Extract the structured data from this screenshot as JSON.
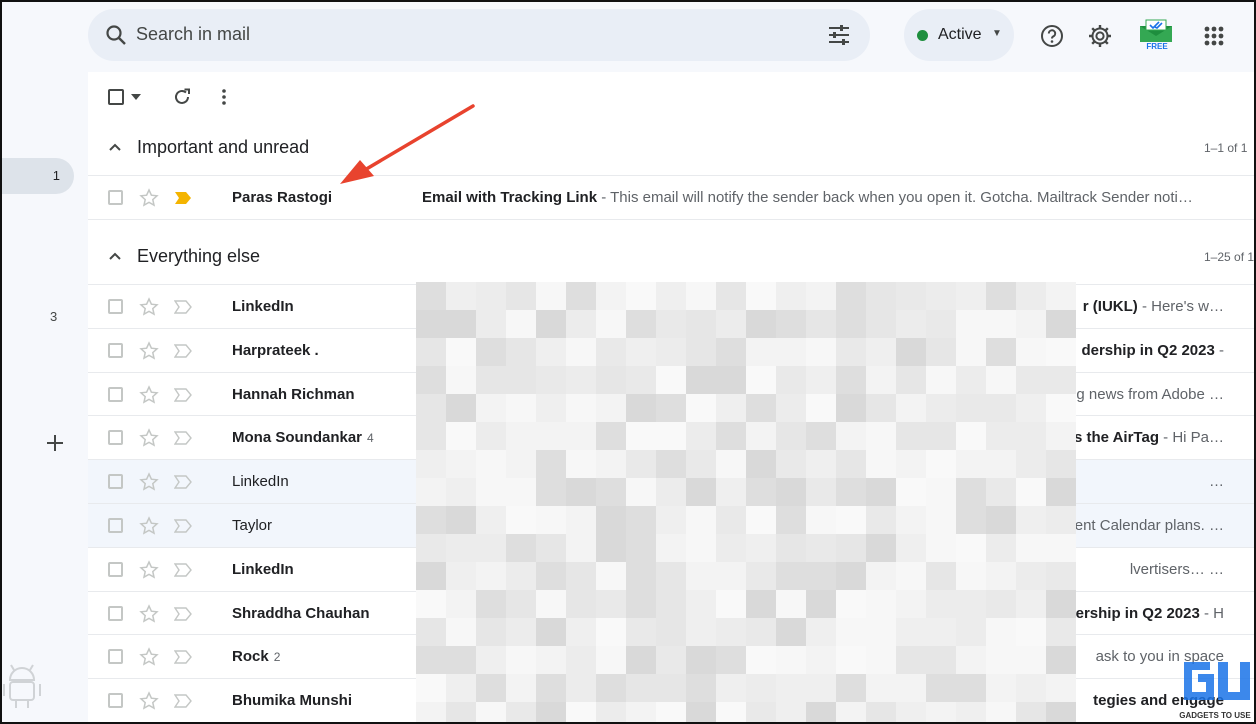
{
  "search": {
    "placeholder": "Search in mail"
  },
  "status": {
    "label": "Active"
  },
  "extension": {
    "badge": "FREE"
  },
  "rail": {
    "badge_count": "1",
    "other_count": "3"
  },
  "sections": [
    {
      "title": "Important and unread",
      "range": "1–1 of 1"
    },
    {
      "title": "Everything else",
      "range": "1–25 of 1"
    }
  ],
  "important_rows": [
    {
      "sender": "Paras Rastogi",
      "count": "",
      "subject": "Email with Tracking Link",
      "snippet": " - This email will notify the sender back when you open it. Gotcha. Mailtrack Sender noti…",
      "important": true,
      "unread": true
    }
  ],
  "rows": [
    {
      "sender": "LinkedIn",
      "count": "",
      "tail_bold": "r (IUKL)",
      "tail_snip": " - Here's w…",
      "unread": true
    },
    {
      "sender": "Harprateek .",
      "count": "",
      "tail_bold": "dership in Q2 2023",
      "tail_snip": " - ",
      "unread": true
    },
    {
      "sender": "Hannah Richman",
      "count": "",
      "tail_bold": "",
      "tail_snip": "g news from Adobe …",
      "unread": true
    },
    {
      "sender": "Mona Soundankar",
      "count": "4",
      "tail_bold": "s the AirTag",
      "tail_snip": " - Hi Pa…",
      "unread": true
    },
    {
      "sender": "LinkedIn",
      "count": "",
      "tail_bold": "",
      "tail_snip": "…",
      "unread": false
    },
    {
      "sender": "Taylor",
      "count": "",
      "tail_bold": "",
      "tail_snip": "ent Calendar plans. …",
      "unread": false
    },
    {
      "sender": "LinkedIn",
      "count": "",
      "tail_bold": "",
      "tail_snip": "lvertisers… …",
      "unread": true
    },
    {
      "sender": "Shraddha Chauhan",
      "count": "",
      "tail_bold": "dership in Q2 2023",
      "tail_snip": " - H",
      "unread": true
    },
    {
      "sender": "Rock",
      "count": "2",
      "tail_bold": "",
      "tail_snip": "ask to you in space",
      "unread": true
    },
    {
      "sender": "Bhumika Munshi",
      "count": "",
      "tail_bold": "tegies and engage",
      "tail_snip": "",
      "unread": true
    }
  ],
  "watermark": {
    "text": "GADGETS TO USE"
  },
  "colors": {
    "accent_active": "#1e8e3e",
    "important_marker": "#f4b400",
    "arrow": "#e8432e"
  }
}
